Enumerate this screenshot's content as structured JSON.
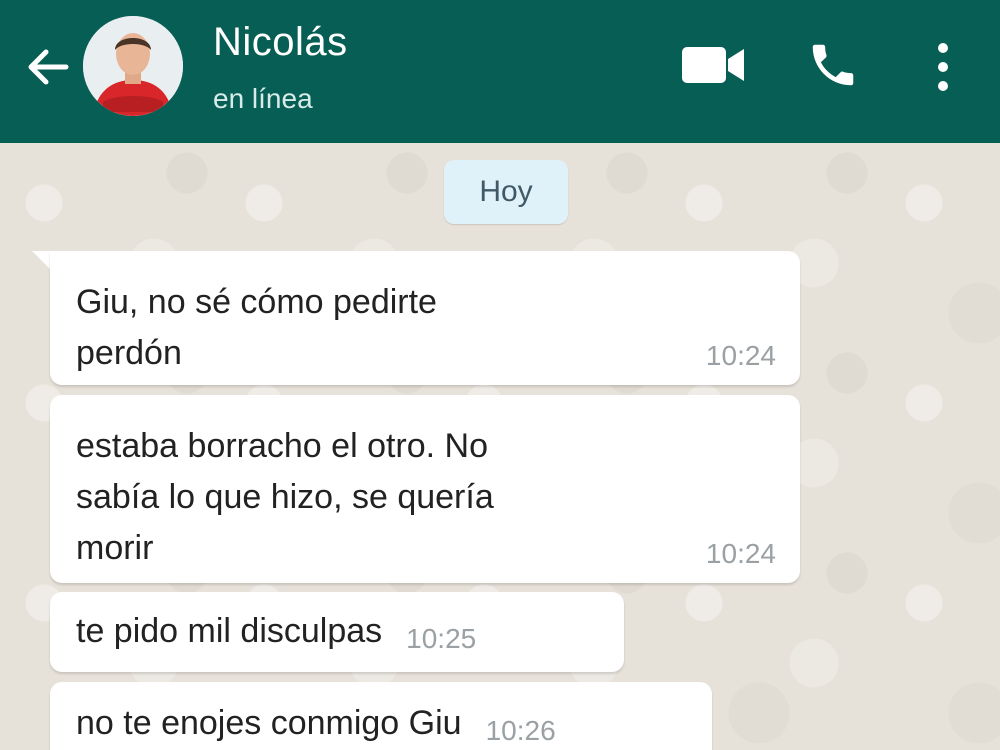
{
  "header": {
    "back_icon": "arrow-left-icon",
    "contact_name": "Nicolás",
    "status": "en línea",
    "actions": [
      "video-call-icon",
      "phone-icon",
      "more-vert-icon"
    ],
    "background_color": "#075e54"
  },
  "chat": {
    "date_divider": "Hoy",
    "messages": [
      {
        "text": "Giu, no sé cómo pedirte\nperdón",
        "time": "10:24",
        "direction": "incoming"
      },
      {
        "text": "estaba borracho el otro. No\nsabía lo que hizo, se quería\nmorir",
        "time": "10:24",
        "direction": "incoming"
      },
      {
        "text": "te pido mil disculpas",
        "time": "10:25",
        "direction": "incoming"
      },
      {
        "text": "no te enojes conmigo Giu",
        "time": "10:26",
        "direction": "incoming"
      }
    ]
  }
}
